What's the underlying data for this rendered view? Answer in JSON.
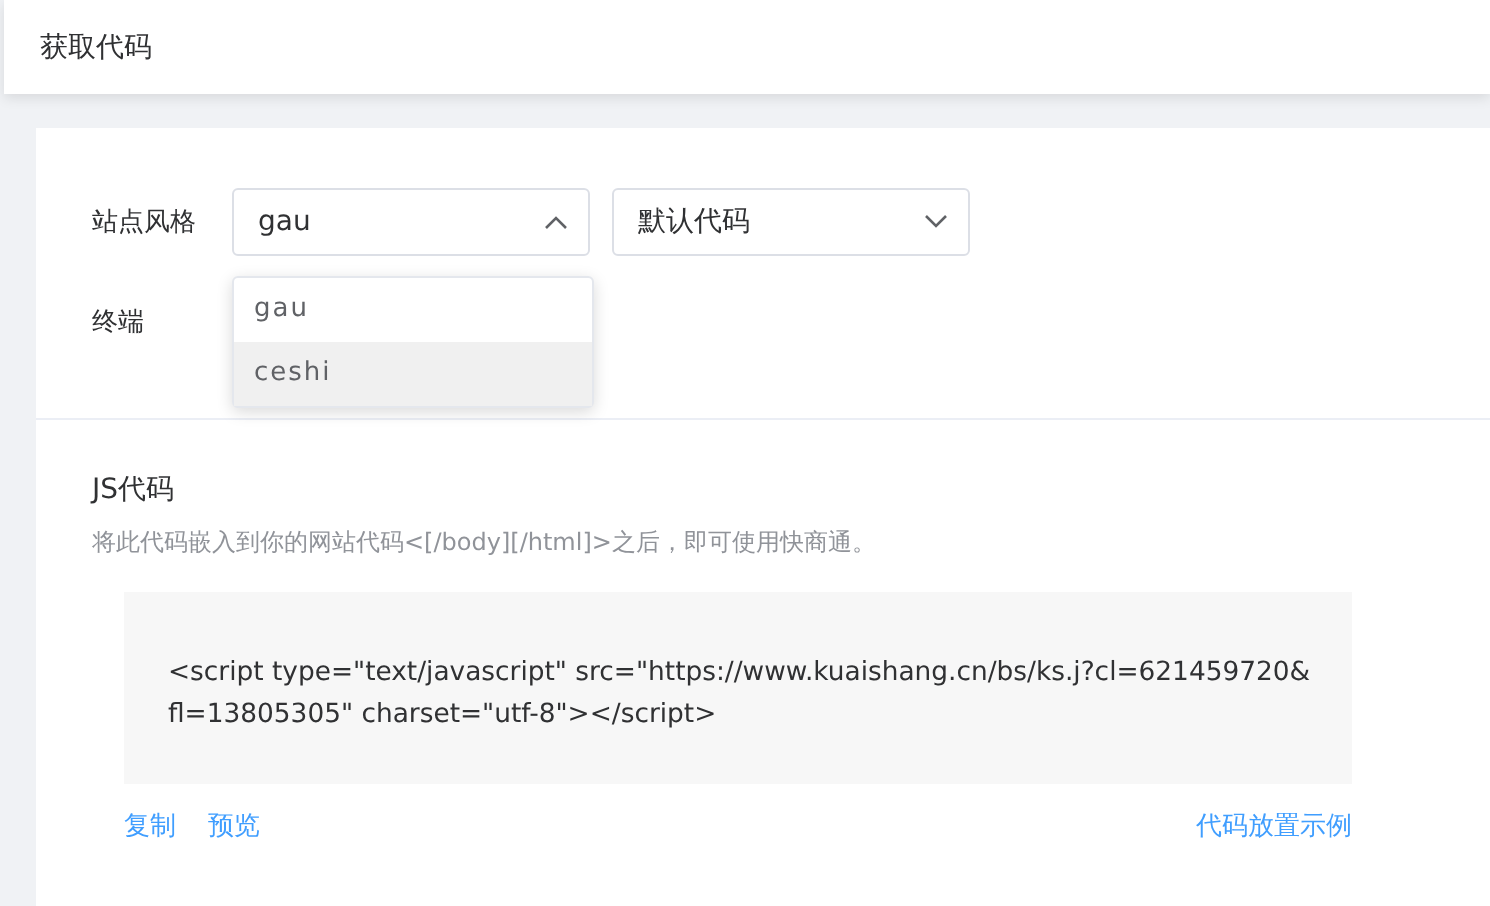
{
  "header": {
    "title": "获取代码"
  },
  "form": {
    "style_label": "站点风格",
    "selects": [
      {
        "value": "gau",
        "expanded": true,
        "options": [
          {
            "label": "gau",
            "highlighted": false
          },
          {
            "label": "ceshi",
            "highlighted": true
          }
        ]
      },
      {
        "value": "默认代码",
        "expanded": false
      }
    ],
    "terminal_label": "终端"
  },
  "js": {
    "title": "JS代码",
    "description": "将此代码嵌入到你的网站代码<[/body][/html]>之后，即可使用快商通。",
    "code": "<script type=\"text/javascript\" src=\"https://www.kuaishang.cn/bs/ks.j?cl=621459720&fl=13805305\" charset=\"utf-8\"></script>",
    "actions": [
      "复制",
      "预览"
    ],
    "example_link": "代码放置示例"
  }
}
